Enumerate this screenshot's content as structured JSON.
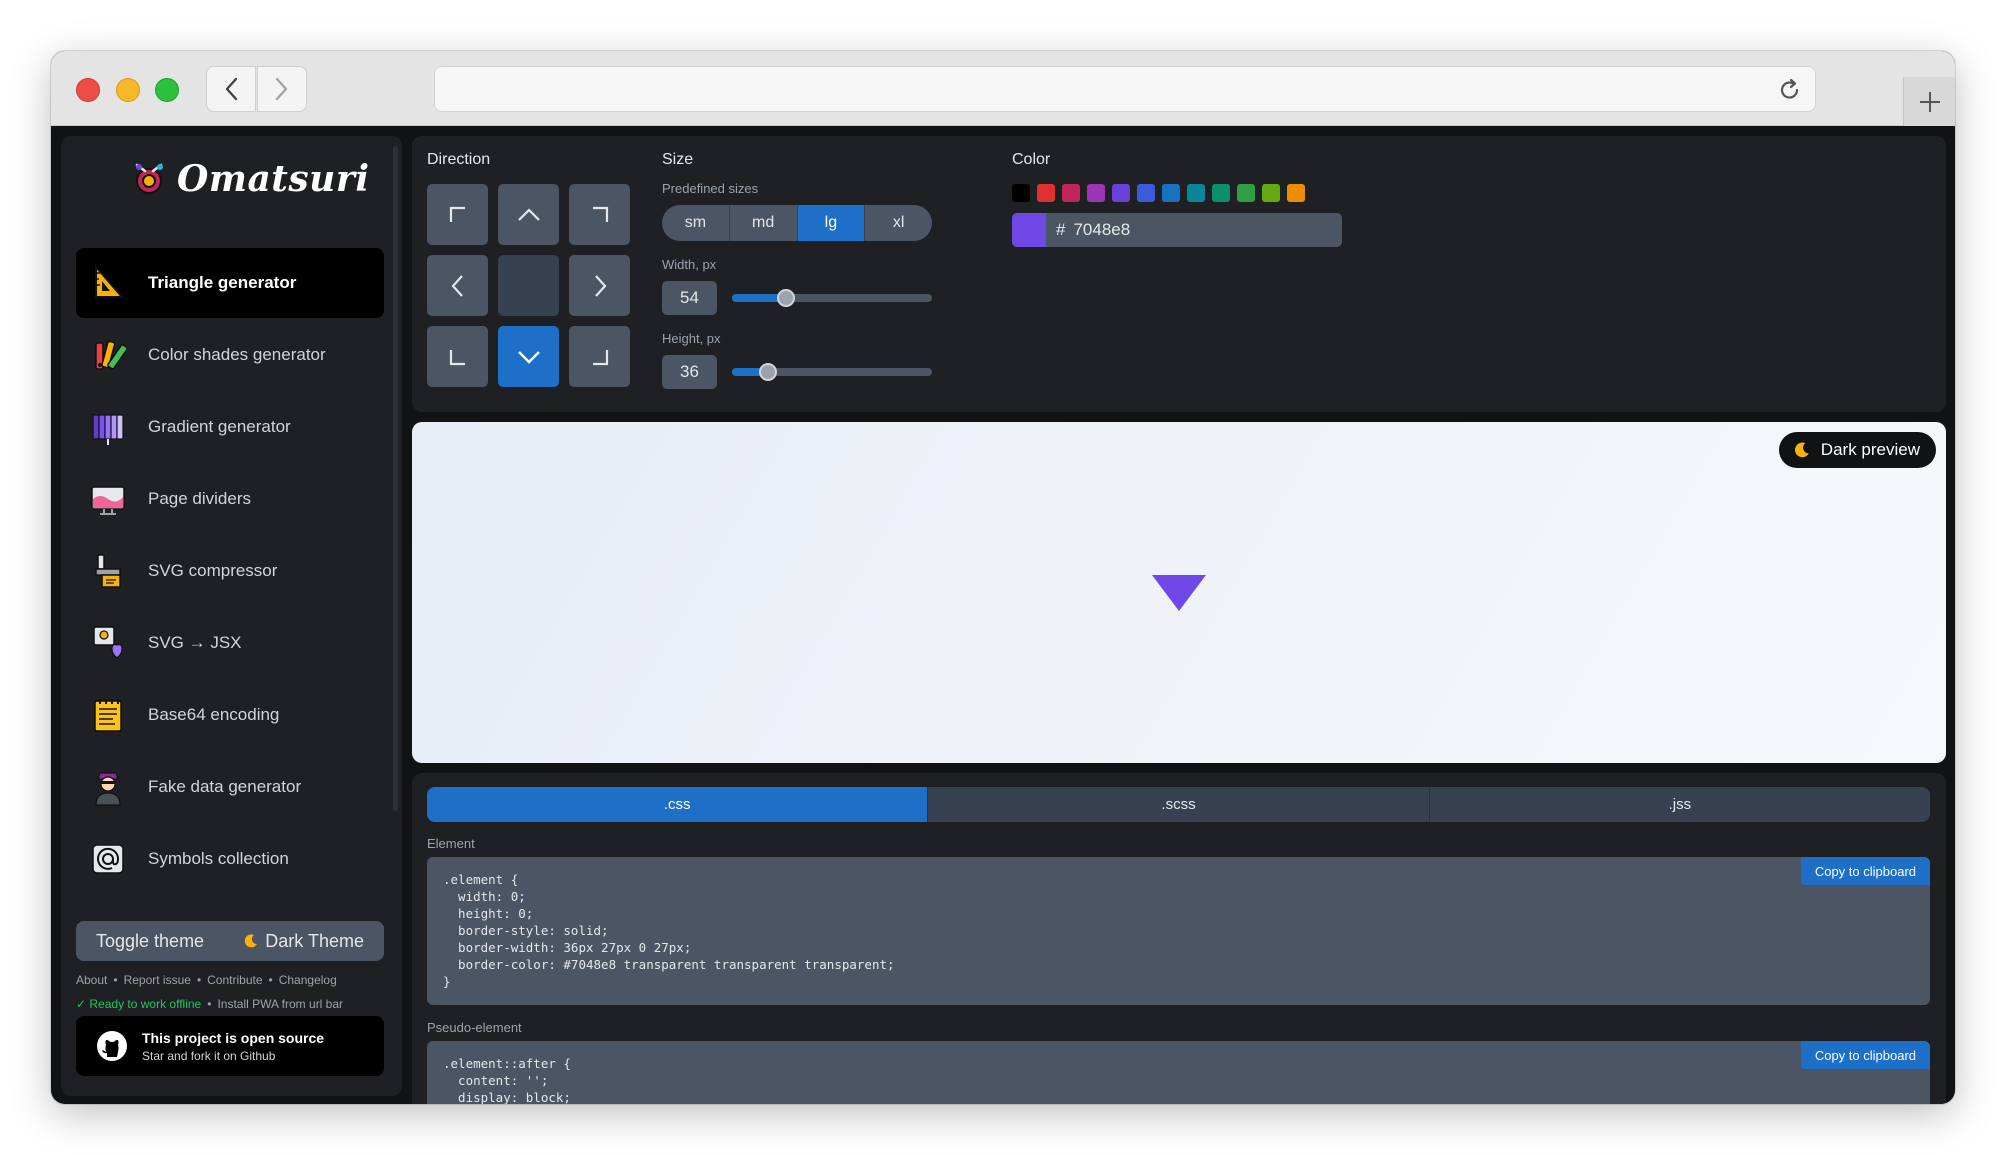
{
  "brand": {
    "name": "Omatsuri"
  },
  "nav": [
    {
      "label": "Triangle generator",
      "icon": "triangle-ruler-icon",
      "active": true
    },
    {
      "label": "Color shades generator",
      "icon": "color-palette-icon",
      "active": false
    },
    {
      "label": "Gradient generator",
      "icon": "gradient-icon",
      "active": false
    },
    {
      "label": "Page dividers",
      "icon": "monitor-waves-icon",
      "active": false
    },
    {
      "label": "SVG compressor",
      "icon": "compressor-icon",
      "active": false
    },
    {
      "label": "SVG → JSX",
      "icon": "svg-jsx-icon",
      "active": false
    },
    {
      "label": "Base64 encoding",
      "icon": "notepad-icon",
      "active": false
    },
    {
      "label": "Fake data generator",
      "icon": "spy-person-icon",
      "active": false
    },
    {
      "label": "Symbols collection",
      "icon": "at-symbol-icon",
      "active": false
    }
  ],
  "theme": {
    "toggle_label": "Toggle theme",
    "current_label": "Dark Theme"
  },
  "footer": {
    "links": [
      "About",
      "Report issue",
      "Contribute",
      "Changelog"
    ],
    "offline_status": "✓ Ready to work offline",
    "pwa_hint": "Install PWA from url bar"
  },
  "opensource": {
    "title": "This project is open source",
    "subtitle": "Star and fork it on Github"
  },
  "controls": {
    "direction_label": "Direction",
    "direction_selected": "bottom",
    "size_label": "Size",
    "predefined_label": "Predefined sizes",
    "sizes": [
      "sm",
      "md",
      "lg",
      "xl"
    ],
    "size_selected": "lg",
    "width_label": "Width, px",
    "width_value": "54",
    "height_label": "Height, px",
    "height_value": "36",
    "width_slider_fraction": 0.27,
    "height_slider_fraction": 0.18,
    "color_label": "Color",
    "swatches": [
      "#000000",
      "#e03131",
      "#c2255c",
      "#9c36b5",
      "#6741d9",
      "#3b5bdb",
      "#1971c2",
      "#0c8599",
      "#099268",
      "#2f9e44",
      "#66a80f",
      "#f08c00"
    ],
    "color_hash": "#",
    "color_value": "7048e8",
    "accent_color": "#7048e8"
  },
  "preview": {
    "dark_preview_label": "Dark preview"
  },
  "code": {
    "tabs": [
      ".css",
      ".scss",
      ".jss"
    ],
    "active_tab": ".css",
    "element_label": "Element",
    "element_code": ".element {\n  width: 0;\n  height: 0;\n  border-style: solid;\n  border-width: 36px 27px 0 27px;\n  border-color: #7048e8 transparent transparent transparent;\n}",
    "pseudo_label": "Pseudo-element",
    "pseudo_code": ".element::after {\n  content: '';\n  display: block;",
    "copy_label": "Copy to clipboard"
  }
}
